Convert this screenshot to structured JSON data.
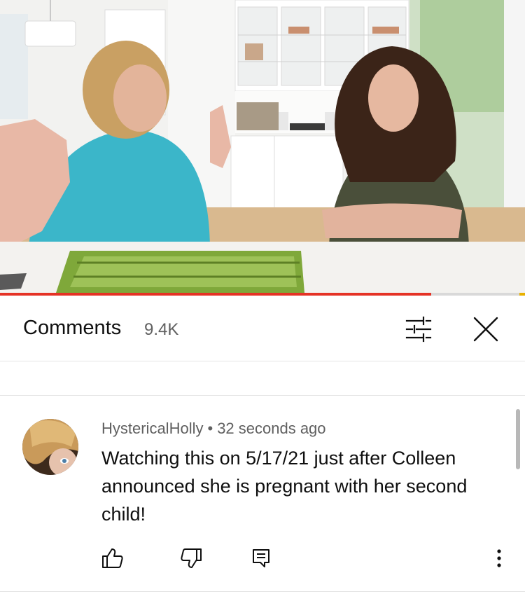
{
  "video": {
    "description_icon": "video-frame",
    "progress_fraction": 0.822,
    "progress_color": "#e53225"
  },
  "comments_panel": {
    "title": "Comments",
    "count": "9.4K",
    "filter_icon": "sliders-icon",
    "close_icon": "close-icon"
  },
  "comment": {
    "author": "HystericalHolly",
    "separator": "•",
    "time": "32 seconds ago",
    "text": "Watching this on 5/17/21 just after Colleen announced she is pregnant with her second child!",
    "actions": {
      "like_icon": "thumbs-up-icon",
      "dislike_icon": "thumbs-down-icon",
      "reply_icon": "reply-icon",
      "more_icon": "more-vertical-icon"
    }
  },
  "colors": {
    "text_primary": "#0f0f0f",
    "text_secondary": "#606060",
    "divider": "#e5e5e5",
    "accent_red": "#e53225"
  }
}
